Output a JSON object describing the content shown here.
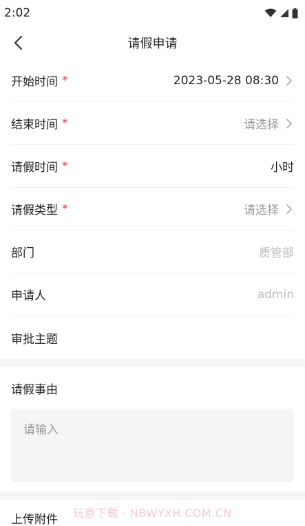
{
  "status_bar": {
    "time": "2:02"
  },
  "nav": {
    "title": "请假申请"
  },
  "form": {
    "start_time": {
      "label": "开始时间",
      "required": "*",
      "value": "2023-05-28 08:30"
    },
    "end_time": {
      "label": "结束时间",
      "required": "*",
      "value": "请选择"
    },
    "duration": {
      "label": "请假时间",
      "required": "*",
      "value": "小时"
    },
    "leave_type": {
      "label": "请假类型",
      "required": "*",
      "value": "请选择"
    },
    "department": {
      "label": "部门",
      "value": "质管部"
    },
    "applicant": {
      "label": "申请人",
      "value": "admin"
    },
    "subject": {
      "label": "审批主题",
      "value": ""
    }
  },
  "reason": {
    "title": "请假事由",
    "placeholder": "请输入"
  },
  "attachments": {
    "title": "上传附件"
  },
  "watermark": "玩意下载 · NBWYXH.COM.CN",
  "colors": {
    "required": "#e03030",
    "placeholder": "#999999",
    "section_bg": "#f5f5f5"
  },
  "icons": [
    "wifi-icon",
    "signal-icon",
    "battery-icon",
    "back-arrow-icon",
    "chevron-right-icon"
  ]
}
